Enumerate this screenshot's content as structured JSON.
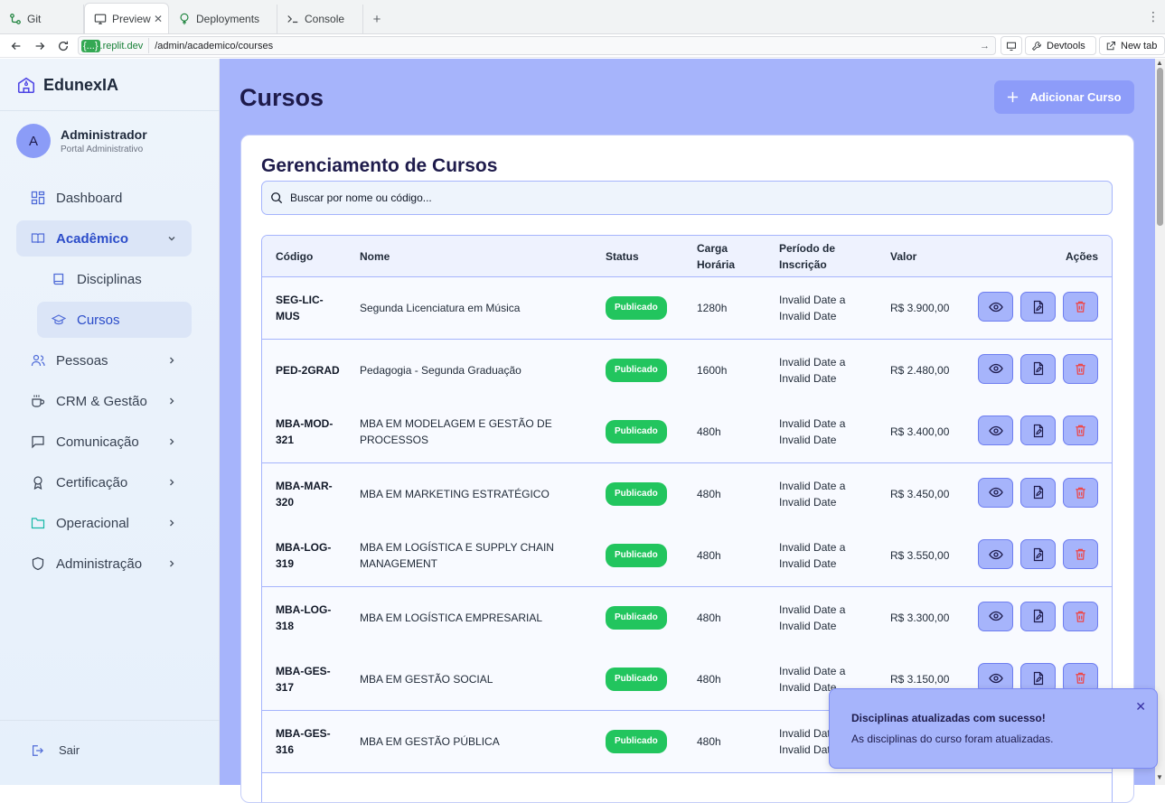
{
  "browser": {
    "tabs": [
      {
        "label": "Git",
        "icon": "git-icon"
      },
      {
        "label": "Preview",
        "icon": "monitor-icon",
        "active": true
      },
      {
        "label": "Deployments",
        "icon": "deploy-icon"
      },
      {
        "label": "Console",
        "icon": "terminal-icon"
      }
    ],
    "url_host": "{...}",
    "url_domain": ".replit.dev",
    "url_path": "/admin/academico/courses",
    "devtools_label": "Devtools",
    "newtab_label": "New tab"
  },
  "sidebar": {
    "brand": "EdunexIA",
    "user": {
      "initial": "A",
      "name": "Administrador",
      "role": "Portal Administrativo"
    },
    "items": [
      {
        "label": "Dashboard",
        "icon": "grid-icon",
        "expandable": false
      },
      {
        "label": "Acadêmico",
        "icon": "book-open-icon",
        "expandable": true,
        "active": true,
        "expanded": true
      },
      {
        "label": "Disciplinas",
        "icon": "book-icon",
        "sub": true
      },
      {
        "label": "Cursos",
        "icon": "graduation-cap-icon",
        "sub": true,
        "active": true
      },
      {
        "label": "Pessoas",
        "icon": "users-icon",
        "expandable": true
      },
      {
        "label": "CRM & Gestão",
        "icon": "coffee-icon",
        "expandable": true
      },
      {
        "label": "Comunicação",
        "icon": "message-icon",
        "expandable": true
      },
      {
        "label": "Certificação",
        "icon": "award-icon",
        "expandable": true
      },
      {
        "label": "Operacional",
        "icon": "folder-icon",
        "expandable": true
      },
      {
        "label": "Administração",
        "icon": "shield-icon",
        "expandable": true
      }
    ],
    "logout_label": "Sair"
  },
  "page": {
    "title": "Cursos",
    "add_button_label": "Adicionar Curso",
    "card_title": "Gerenciamento de Cursos",
    "search_placeholder": "Buscar por nome ou código..."
  },
  "table": {
    "headers": {
      "code": "Código",
      "name": "Nome",
      "status": "Status",
      "workload": "Carga Horária",
      "period": "Período de Inscrição",
      "price": "Valor",
      "actions": "Ações"
    },
    "rows": [
      {
        "code": "SEG-LIC-MUS",
        "name": "Segunda Licenciatura em Música",
        "status": "Publicado",
        "workload": "1280h",
        "period": "Invalid Date a Invalid Date",
        "price": "R$ 3.900,00"
      },
      {
        "code": "PED-2GRAD",
        "name": "Pedagogia - Segunda Graduação",
        "status": "Publicado",
        "workload": "1600h",
        "period": "Invalid Date a Invalid Date",
        "price": "R$ 2.480,00"
      },
      {
        "code": "MBA-MOD-321",
        "name": "MBA EM MODELAGEM E GESTÃO DE PROCESSOS",
        "status": "Publicado",
        "workload": "480h",
        "period": "Invalid Date a Invalid Date",
        "price": "R$ 3.400,00"
      },
      {
        "code": "MBA-MAR-320",
        "name": "MBA EM MARKETING ESTRATÉGICO",
        "status": "Publicado",
        "workload": "480h",
        "period": "Invalid Date a Invalid Date",
        "price": "R$ 3.450,00"
      },
      {
        "code": "MBA-LOG-319",
        "name": "MBA EM LOGÍSTICA E SUPPLY CHAIN MANAGEMENT",
        "status": "Publicado",
        "workload": "480h",
        "period": "Invalid Date a Invalid Date",
        "price": "R$ 3.550,00"
      },
      {
        "code": "MBA-LOG-318",
        "name": "MBA EM LOGÍSTICA EMPRESARIAL",
        "status": "Publicado",
        "workload": "480h",
        "period": "Invalid Date a Invalid Date",
        "price": "R$ 3.300,00"
      },
      {
        "code": "MBA-GES-317",
        "name": "MBA EM GESTÃO SOCIAL",
        "status": "Publicado",
        "workload": "480h",
        "period": "Invalid Date a Invalid Date",
        "price": "R$ 3.150,00"
      },
      {
        "code": "MBA-GES-316",
        "name": "MBA EM GESTÃO PÚBLICA",
        "status": "Publicado",
        "workload": "480h",
        "period": "Invalid Date a Invalid Date",
        "price": ""
      }
    ]
  },
  "toast": {
    "title": "Disciplinas atualizadas com sucesso!",
    "description": "As disciplinas do curso foram atualizadas."
  },
  "colors": {
    "main_bg": "#a6b4fb",
    "accent": "#2b4cc9",
    "badge_green": "#22c55e",
    "delete_red": "#ef4444"
  }
}
